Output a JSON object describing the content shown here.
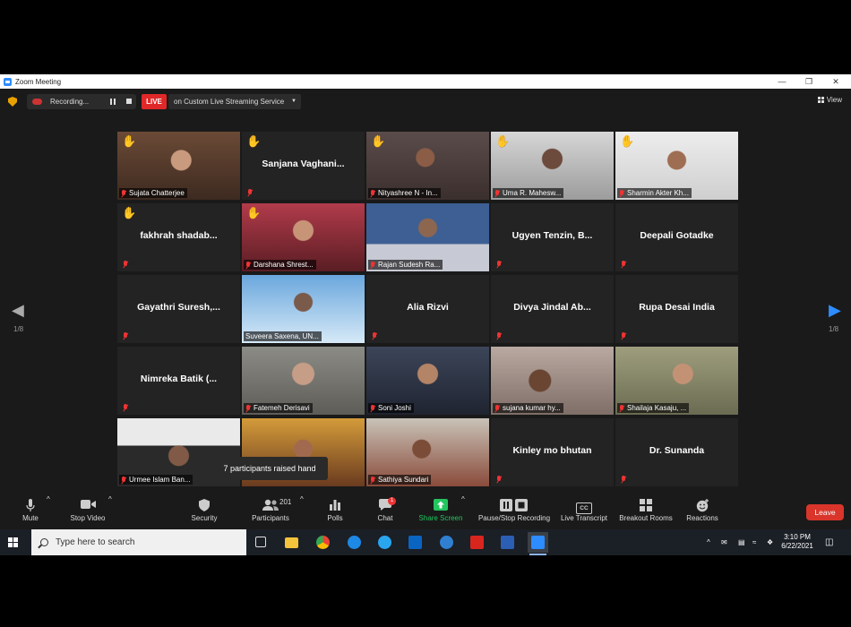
{
  "window": {
    "title": "Zoom Meeting"
  },
  "topbar": {
    "recording_label": "Recording...",
    "live_badge": "LIVE",
    "live_service": "on Custom Live Streaming Service",
    "view_label": "View"
  },
  "navigation": {
    "page_left": "1/8",
    "page_right": "1/8"
  },
  "participants": [
    {
      "name": "Sujata  Chatterjee",
      "video": true,
      "hand": true,
      "active": true
    },
    {
      "name": "Sanjana  Vaghani...",
      "video": false,
      "hand": true
    },
    {
      "name": "Nityashree N - In...",
      "video": true,
      "hand": true
    },
    {
      "name": "Uma R. Mahesw...",
      "video": true,
      "hand": true
    },
    {
      "name": "Sharmin Akter Kh...",
      "video": true,
      "hand": true
    },
    {
      "name": "fakhrah  shadab...",
      "video": false,
      "hand": true
    },
    {
      "name": "Darshana Shrest...",
      "video": true,
      "hand": true
    },
    {
      "name": "Rajan Sudesh Ra...",
      "video": true,
      "hand": false,
      "pinned": true
    },
    {
      "name": "Ugyen  Tenzin,  B...",
      "video": false,
      "hand": false
    },
    {
      "name": "Deepali Gotadke",
      "video": false,
      "hand": false
    },
    {
      "name": "Gayathri  Suresh,...",
      "video": false,
      "hand": false
    },
    {
      "name": "Suveera Saxena, UN...",
      "video": true,
      "hand": false,
      "micLabel": false
    },
    {
      "name": "Alia Rizvi",
      "video": false,
      "hand": false
    },
    {
      "name": "Divya  Jindal  Ab...",
      "video": false,
      "hand": false
    },
    {
      "name": "Rupa Desai India",
      "video": false,
      "hand": false
    },
    {
      "name": "Nimreka Batik  (...",
      "video": false,
      "hand": false
    },
    {
      "name": "Fatemeh Derisavi",
      "video": true,
      "hand": false
    },
    {
      "name": "Soni Joshi",
      "video": true,
      "hand": false
    },
    {
      "name": "sujana kumar hy...",
      "video": true,
      "hand": false
    },
    {
      "name": "Shailaja Kasaju, ...",
      "video": true,
      "hand": false
    },
    {
      "name": "Urmee Islam Ban...",
      "video": true,
      "hand": false
    },
    {
      "name": "",
      "video": true,
      "hand": false,
      "hidden_label": true
    },
    {
      "name": "Sathiya Sundari",
      "video": true,
      "hand": false
    },
    {
      "name": "Kinley mo bhutan",
      "video": false,
      "hand": false
    },
    {
      "name": "Dr. Sunanda",
      "video": false,
      "hand": false
    }
  ],
  "tooltip": "7 participants raised hand",
  "toolbar": {
    "mute": "Mute",
    "stop_video": "Stop Video",
    "security": "Security",
    "participants": "Participants",
    "participants_count": "201",
    "polls": "Polls",
    "chat": "Chat",
    "chat_badge": "1",
    "share_screen": "Share Screen",
    "pause_stop": "Pause/Stop Recording",
    "live_transcript": "Live Transcript",
    "cc": "CC",
    "breakout": "Breakout Rooms",
    "reactions": "Reactions",
    "leave": "Leave"
  },
  "taskbar": {
    "search_placeholder": "Type here to search",
    "time": "3:10 PM",
    "date": "6/22/2021"
  },
  "colors": {
    "accent": "#2d8cff",
    "live": "#e02828",
    "leave": "#d9352a",
    "share": "#22c55e",
    "active_speaker": "#d7ee5a"
  }
}
